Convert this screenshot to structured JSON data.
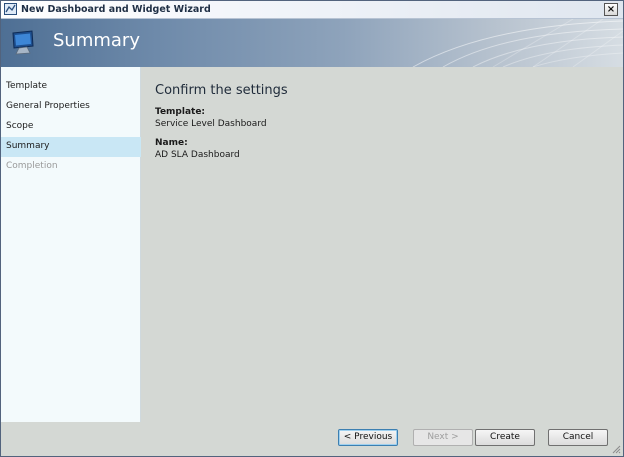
{
  "window": {
    "title": "New Dashboard and Widget Wizard",
    "close_label": "×"
  },
  "banner": {
    "title": "Summary",
    "icon": "monitor-icon"
  },
  "sidebar": {
    "items": [
      {
        "label": "Template",
        "state": "normal"
      },
      {
        "label": "General Properties",
        "state": "normal"
      },
      {
        "label": "Scope",
        "state": "normal"
      },
      {
        "label": "Summary",
        "state": "active"
      },
      {
        "label": "Completion",
        "state": "disabled"
      }
    ]
  },
  "main": {
    "heading": "Confirm the settings",
    "fields": [
      {
        "label": "Template:",
        "value": "Service Level Dashboard"
      },
      {
        "label": "Name:",
        "value": "AD SLA Dashboard"
      }
    ]
  },
  "footer": {
    "previous_label": "< Previous",
    "next_label": "Next >",
    "create_label": "Create",
    "cancel_label": "Cancel"
  },
  "colors": {
    "active_nav": "#c9e7f5",
    "content_bg": "#d4d8d4",
    "sidebar_bg": "#f3fafc"
  }
}
